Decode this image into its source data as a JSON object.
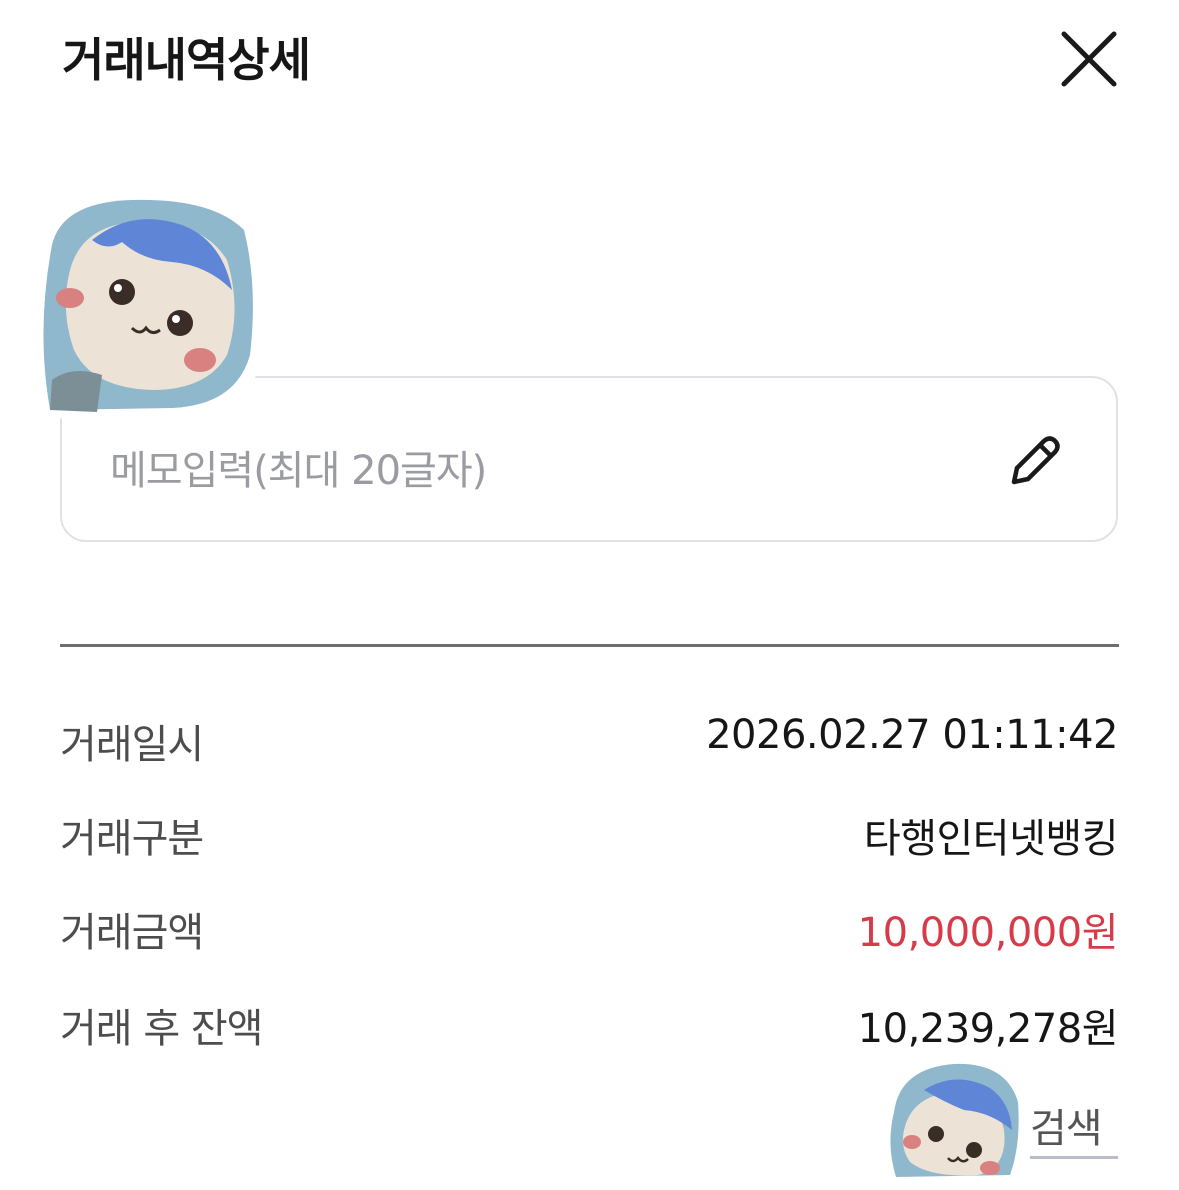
{
  "header": {
    "title": "거래내역상세"
  },
  "icons": {
    "close": "close-icon",
    "edit": "pencil-icon"
  },
  "memo": {
    "placeholder": "메모입력(최대 20글자)"
  },
  "details": [
    {
      "label": "거래일시",
      "value": "2026.02.27 01:11:42"
    },
    {
      "label": "거래구분",
      "value": "타행인터넷뱅킹"
    },
    {
      "label": "거래금액",
      "value": "10,000,000원"
    },
    {
      "label": "거래 후 잔액",
      "value": "10,239,278원"
    }
  ],
  "search": {
    "label": "검색"
  },
  "colors": {
    "amount_highlight": "#d63b4a",
    "divider": "#6e6e6e",
    "memo_border": "#dfe1e5"
  }
}
